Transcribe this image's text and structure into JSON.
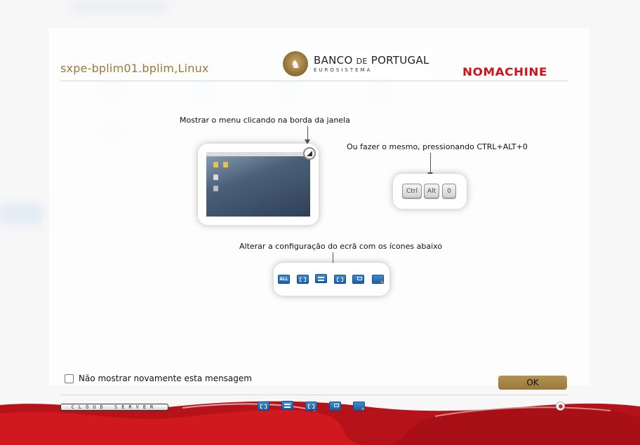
{
  "header": {
    "host_title": "sxpe-bplim01.bplim,Linux",
    "bank_emblem_glyph": "♞",
    "bank_name_part1": "BANCO ",
    "bank_name_de": "DE",
    "bank_name_part2": " PORTUGAL",
    "bank_subtitle": "EUROSISTEMA",
    "brand_logo": "NOMACHINE"
  },
  "tips": {
    "menu_caption": "Mostrar o menu clicando na borda da janela",
    "shortcut_caption": "Ou fazer o mesmo, pressionando CTRL+ALT+0",
    "keys": [
      "Ctrl",
      "Alt",
      "0"
    ],
    "display_caption": "Alterar a configuração do ecrã com os ícones abaixo"
  },
  "display_icons": [
    {
      "label": "ALL",
      "icon": "all-monitors-icon"
    },
    {
      "label": "",
      "icon": "fit-to-window-icon"
    },
    {
      "label": "",
      "icon": "viewport-icon"
    },
    {
      "label": "",
      "icon": "fullscreen-icon"
    },
    {
      "label": "",
      "icon": "resize-remote-icon"
    },
    {
      "label": "",
      "icon": "display-settings-icon"
    }
  ],
  "footer": {
    "dont_show_label": "Não mostrar novamente esta mensagem",
    "ok_label": "OK",
    "cloud_badge": "CLOUD SERVER"
  },
  "colors": {
    "title_gold": "#9a7a3a",
    "brand_red": "#d3121a",
    "button_gold": "#a88a4b",
    "footer_red": "#c8161d"
  }
}
